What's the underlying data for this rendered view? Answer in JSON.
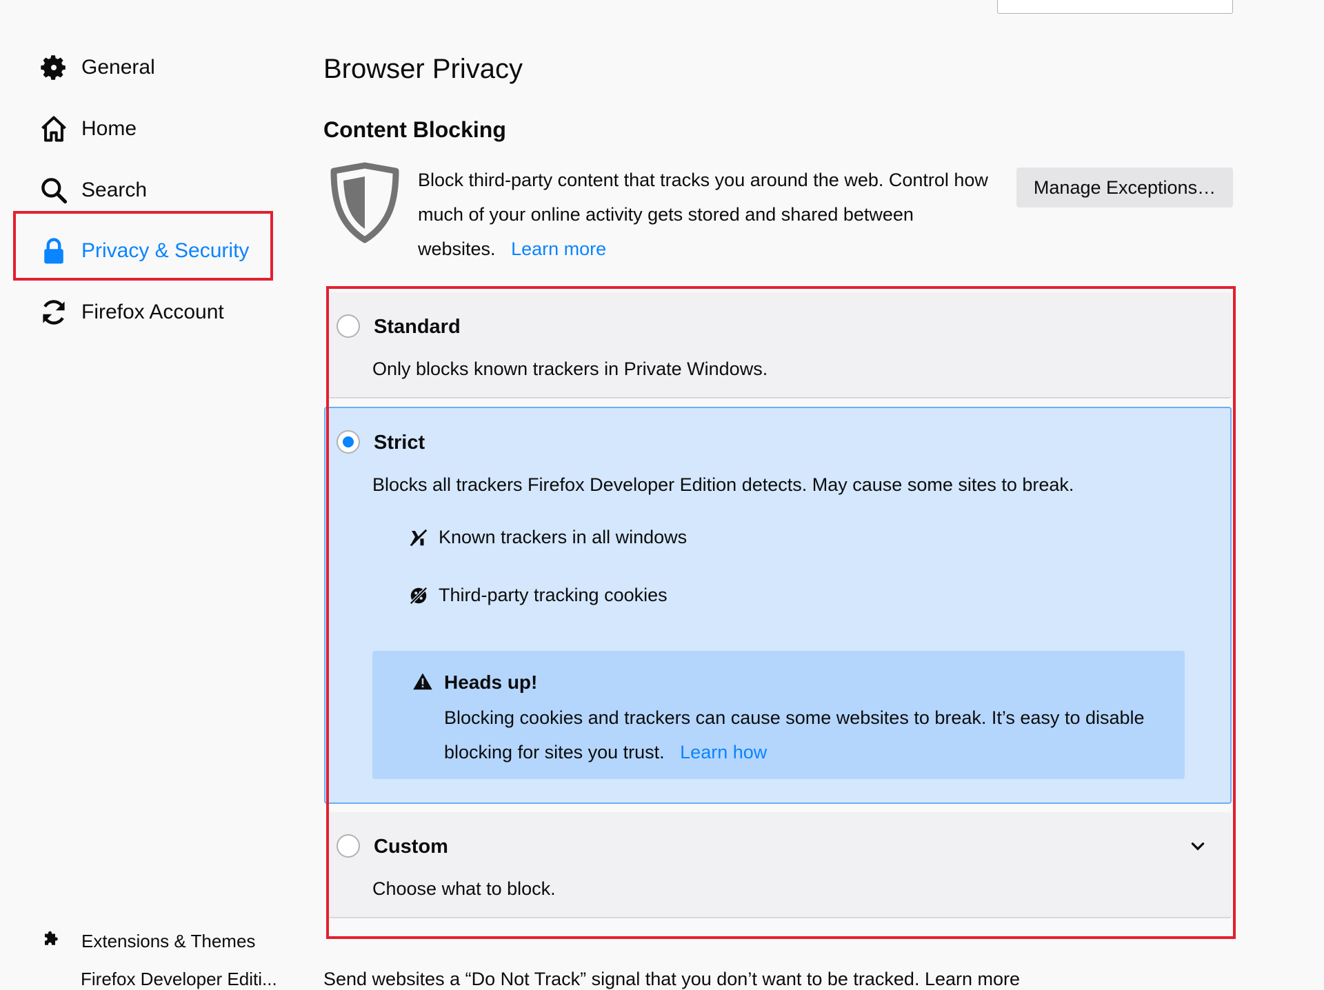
{
  "sidebar": {
    "items": [
      {
        "label": "General",
        "icon": "gear-icon"
      },
      {
        "label": "Home",
        "icon": "home-icon"
      },
      {
        "label": "Search",
        "icon": "search-icon"
      },
      {
        "label": "Privacy & Security",
        "icon": "lock-icon",
        "selected": true
      },
      {
        "label": "Firefox Account",
        "icon": "sync-icon"
      }
    ],
    "extensions": {
      "label": "Extensions & Themes",
      "icon": "puzzle-icon"
    },
    "bottom_cut": "Firefox Developer Editi..."
  },
  "main": {
    "page_title": "Browser Privacy",
    "section_title": "Content Blocking",
    "description": "Block third-party content that tracks you around the web. Control how much of your online activity gets stored and shared between websites.",
    "learn_more": "Learn more",
    "manage_button": "Manage Exceptions…",
    "options": {
      "standard": {
        "title": "Standard",
        "desc": "Only blocks known trackers in Private Windows.",
        "checked": false
      },
      "strict": {
        "title": "Strict",
        "desc": "Blocks all trackers Firefox Developer Edition detects. May cause some sites to break.",
        "checked": true,
        "features": [
          {
            "label": "Known trackers in all windows",
            "icon": "tracker-blocked-icon"
          },
          {
            "label": "Third-party tracking cookies",
            "icon": "cookie-blocked-icon"
          }
        ],
        "heads_up": {
          "title": "Heads up!",
          "text": "Blocking cookies and trackers can cause some websites to break. It’s easy to disable blocking for sites you trust.",
          "link": "Learn how"
        }
      },
      "custom": {
        "title": "Custom",
        "desc": "Choose what to block.",
        "checked": false
      }
    },
    "dnt_cut": "Send websites a “Do Not Track” signal that you don’t want to be tracked. Learn more"
  },
  "colors": {
    "accent": "#0a84ff",
    "highlight": "#e22030",
    "strict_bg": "#d4e7fd",
    "headsup_bg": "#b4d6fd"
  }
}
